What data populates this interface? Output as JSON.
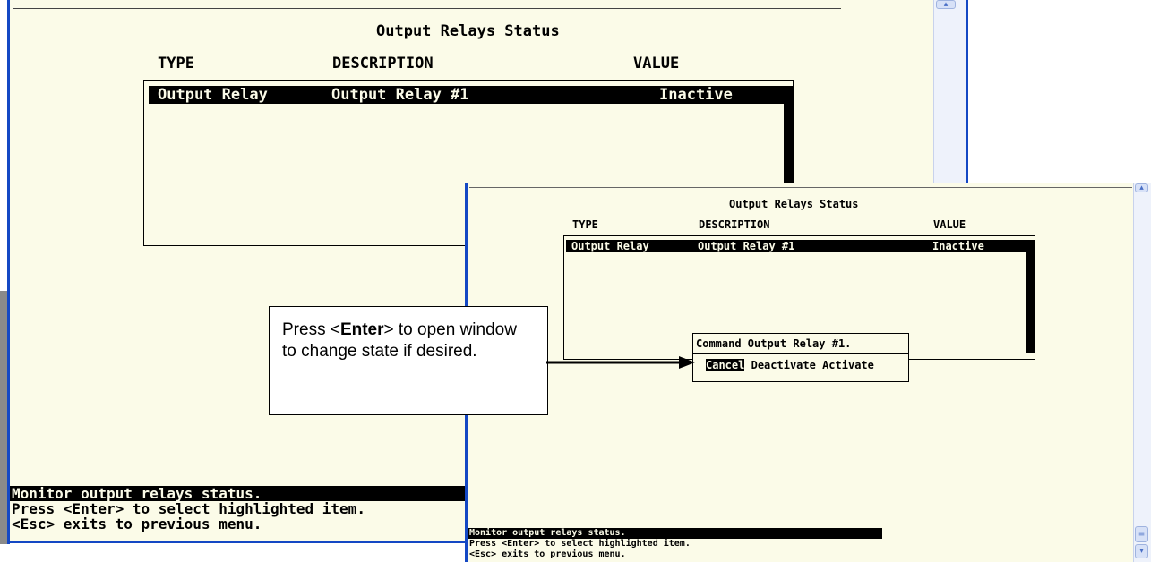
{
  "back_window": {
    "title": "Output Relays Status",
    "columns": [
      "TYPE",
      "DESCRIPTION",
      "VALUE"
    ],
    "rows": [
      {
        "type": "Output Relay",
        "description": "Output Relay #1",
        "value": "Inactive"
      }
    ],
    "status_lines": [
      "Monitor output relays status.",
      "Press <Enter> to select highlighted item.",
      "<Esc> exits to previous menu."
    ]
  },
  "front_window": {
    "title": "Output Relays Status",
    "columns": [
      "TYPE",
      "DESCRIPTION",
      "VALUE"
    ],
    "rows": [
      {
        "type": "Output Relay",
        "description": "Output Relay #1",
        "value": "Inactive"
      }
    ],
    "dialog": {
      "title": "Command Output Relay #1.",
      "options": [
        "Cancel",
        "Deactivate",
        "Activate"
      ],
      "selected": "Cancel"
    },
    "status_lines": [
      "Monitor output relays status.",
      "Press <Enter> to select highlighted item.",
      "<Esc> exits to previous menu."
    ]
  },
  "callout": {
    "text_prefix": "Press <",
    "text_bold": "Enter",
    "text_suffix": "> to open window to change state if desired."
  },
  "colors": {
    "terminal_bg": "#fbfbe8",
    "window_border": "#1448c4",
    "text": "#000000"
  }
}
